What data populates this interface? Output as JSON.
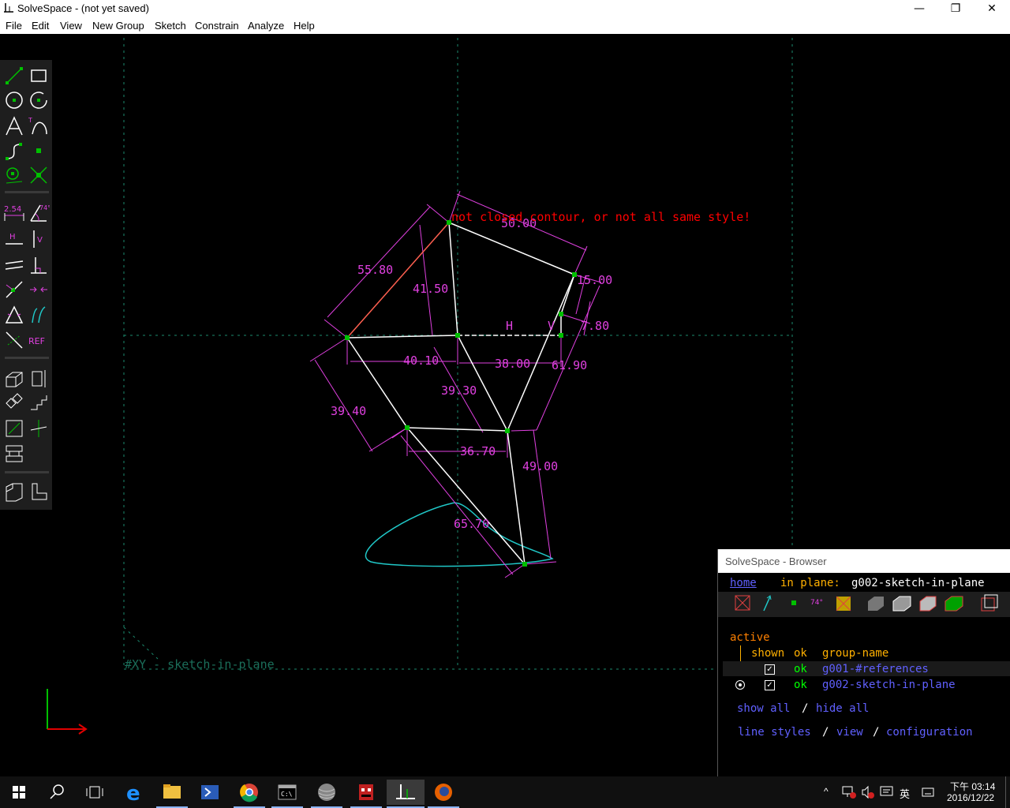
{
  "window": {
    "title": "SolveSpace - (not yet saved)"
  },
  "menu": [
    "File",
    "Edit",
    "View",
    "New Group",
    "Sketch",
    "Constrain",
    "Analyze",
    "Help"
  ],
  "toolbar": {
    "buttons": [
      "line",
      "rectangle",
      "circle",
      "arc",
      "text",
      "tangent-arc",
      "bezier",
      "point",
      "construction-point",
      "split",
      "distance",
      "angle",
      "horizontal",
      "vertical",
      "parallel",
      "perpendicular",
      "point-on",
      "symmetric",
      "equal",
      "tangent",
      "construction",
      "reference",
      "extrude",
      "lathe",
      "step-translate",
      "step-rotate",
      "workplane",
      "nearest-iso",
      "assemble",
      "section",
      "import",
      "new-sketch"
    ],
    "dim_label": "2.54",
    "angle_label": "74°",
    "ref_label": "REF",
    "h_label": "H",
    "v_label": "V"
  },
  "sketch": {
    "error_message": "not closed contour, or not all same style!",
    "dimensions": [
      "55.80",
      "50.00",
      "15.00",
      "41.50",
      "7.80",
      "40.10",
      "38.00",
      "61.90",
      "39.30",
      "39.40",
      "36.70",
      "49.00",
      "65.70"
    ],
    "constraint_labels": {
      "horizontal": "H",
      "vertical": "V"
    },
    "workplane_label": "#XY - sketch-in-plane"
  },
  "browser": {
    "title": "SolveSpace - Browser",
    "home": "home",
    "in_plane_label": "in plane:",
    "in_plane_value": "g002-sketch-in-plane",
    "active": "active",
    "columns": {
      "shown": "shown",
      "ok": "ok",
      "group_name": "group-name"
    },
    "groups": [
      {
        "ok": "ok",
        "name": "g001-#references",
        "shown": true,
        "active": false
      },
      {
        "ok": "ok",
        "name": "g002-sketch-in-plane",
        "shown": true,
        "active": true
      }
    ],
    "show_all": "show all",
    "slash": "/",
    "hide_all": "hide all",
    "line_styles": "line styles",
    "view": "view",
    "configuration": "configuration",
    "tool_angle": "74°"
  },
  "taskbar": {
    "apps": [
      "start",
      "search",
      "task-view",
      "edge",
      "file-explorer",
      "powershell",
      "chrome",
      "cmd",
      "sphere-app",
      "red-app",
      "solvespace",
      "firefox"
    ],
    "ime": "英",
    "time": "下午 03:14",
    "date": "2016/12/22"
  },
  "colors": {
    "constraint": "#e040e0",
    "geometry": "#ffffff",
    "point": "#00c000",
    "error": "#ff0000",
    "highlight": "#ff6050",
    "construction": "#1b8a6e",
    "spline": "#20c8c8",
    "browser_link": "#6060ff",
    "browser_ok": "#00ff00",
    "browser_text": "#ffb000",
    "browser_active_text": "#ff8000",
    "toolbar_icon": "#00c000"
  }
}
